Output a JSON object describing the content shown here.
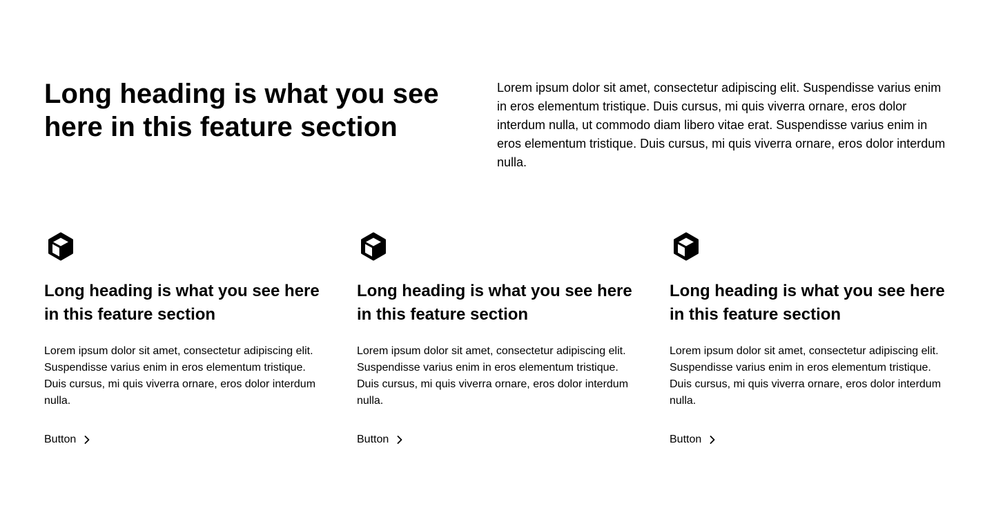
{
  "header": {
    "heading": "Long heading is what you see here in this feature section",
    "paragraph": "Lorem ipsum dolor sit amet, consectetur adipiscing elit. Suspendisse varius enim in eros elementum tristique. Duis cursus, mi quis viverra ornare, eros dolor interdum nulla, ut commodo diam libero vitae erat. Suspendisse varius enim in eros elementum tristique. Duis cursus, mi quis viverra ornare, eros dolor interdum nulla."
  },
  "features": [
    {
      "icon": "cube-icon",
      "heading": "Long heading is what you see here in this feature section",
      "text": "Lorem ipsum dolor sit amet, consectetur adipiscing elit. Suspendisse varius enim in eros elementum tristique. Duis cursus, mi quis viverra ornare, eros dolor interdum nulla.",
      "button_label": "Button",
      "button_icon": "chevron-right-icon"
    },
    {
      "icon": "cube-icon",
      "heading": "Long heading is what you see here in this feature section",
      "text": "Lorem ipsum dolor sit amet, consectetur adipiscing elit. Suspendisse varius enim in eros elementum tristique. Duis cursus, mi quis viverra ornare, eros dolor interdum nulla.",
      "button_label": "Button",
      "button_icon": "chevron-right-icon"
    },
    {
      "icon": "cube-icon",
      "heading": "Long heading is what you see here in this feature section",
      "text": "Lorem ipsum dolor sit amet, consectetur adipiscing elit. Suspendisse varius enim in eros elementum tristique. Duis cursus, mi quis viverra ornare, eros dolor interdum nulla.",
      "button_label": "Button",
      "button_icon": "chevron-right-icon"
    }
  ],
  "colors": {
    "background": "#ffffff",
    "text": "#000000"
  }
}
